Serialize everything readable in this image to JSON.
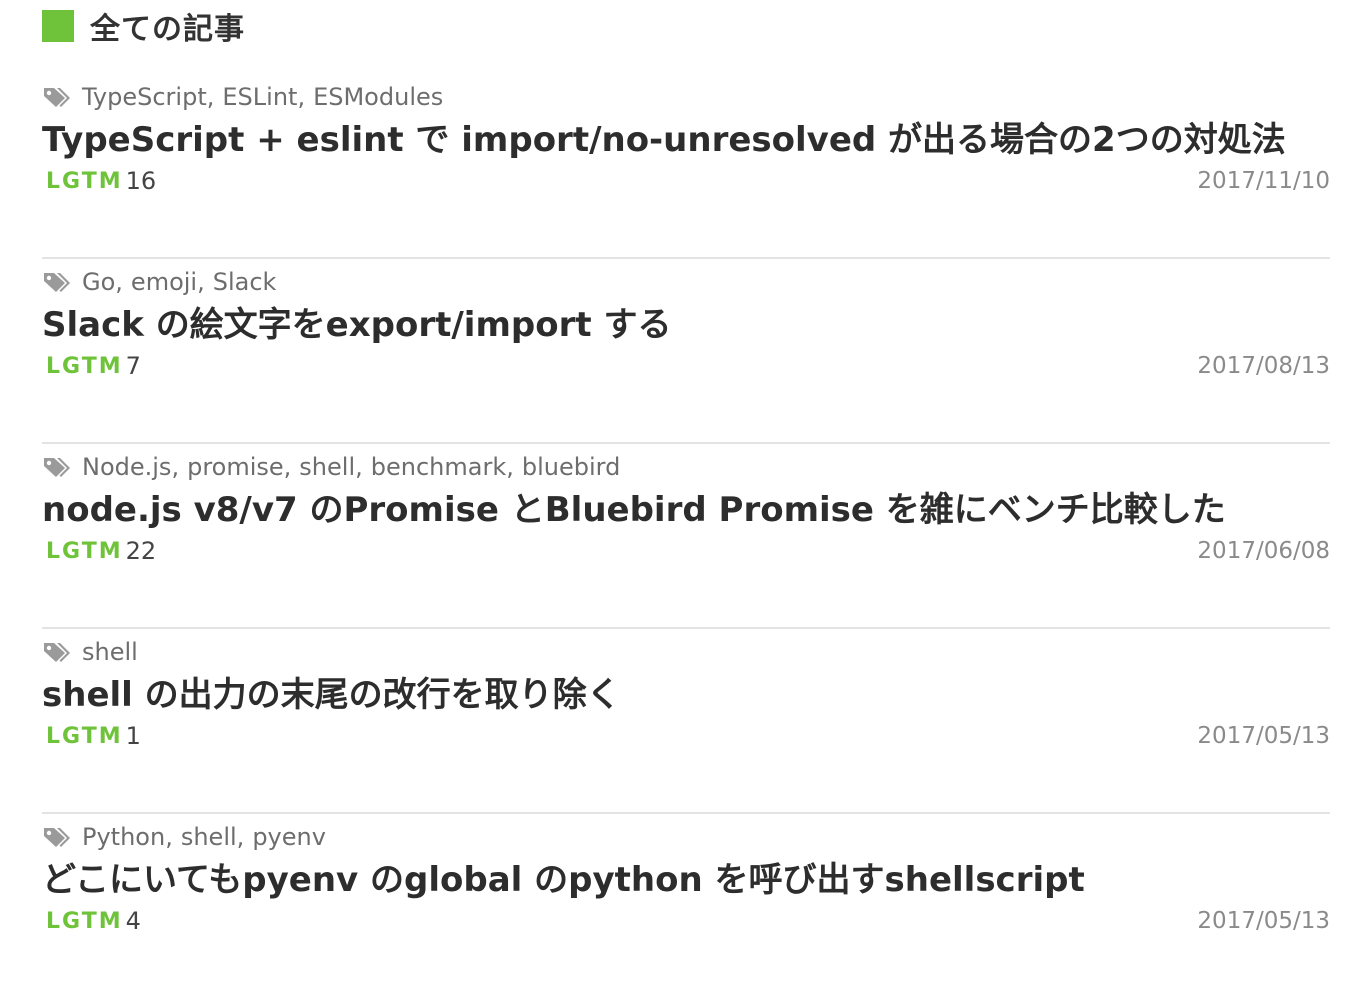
{
  "section": {
    "title": "全ての記事",
    "marker_color": "#6fc33a"
  },
  "lgtm_label": "LGTM",
  "articles": [
    {
      "tags": [
        "TypeScript",
        "ESLint",
        "ESModules"
      ],
      "title": "TypeScript + eslint で import/no-unresolved が出る場合の2つの対処法",
      "lgtm": "16",
      "date": "2017/11/10"
    },
    {
      "tags": [
        "Go",
        "emoji",
        "Slack"
      ],
      "title": "Slack の絵文字をexport/import する",
      "lgtm": "7",
      "date": "2017/08/13"
    },
    {
      "tags": [
        "Node.js",
        "promise",
        "shell",
        "benchmark",
        "bluebird"
      ],
      "title": "node.js v8/v7 のPromise とBluebird Promise を雑にベンチ比較した",
      "lgtm": "22",
      "date": "2017/06/08"
    },
    {
      "tags": [
        "shell"
      ],
      "title": "shell の出力の末尾の改行を取り除く",
      "lgtm": "1",
      "date": "2017/05/13"
    },
    {
      "tags": [
        "Python",
        "shell",
        "pyenv"
      ],
      "title": "どこにいてもpyenv のglobal のpython を呼び出すshellscript",
      "lgtm": "4",
      "date": "2017/05/13"
    }
  ],
  "icons": {
    "tag": "tags-icon",
    "section_marker": "green-square"
  }
}
